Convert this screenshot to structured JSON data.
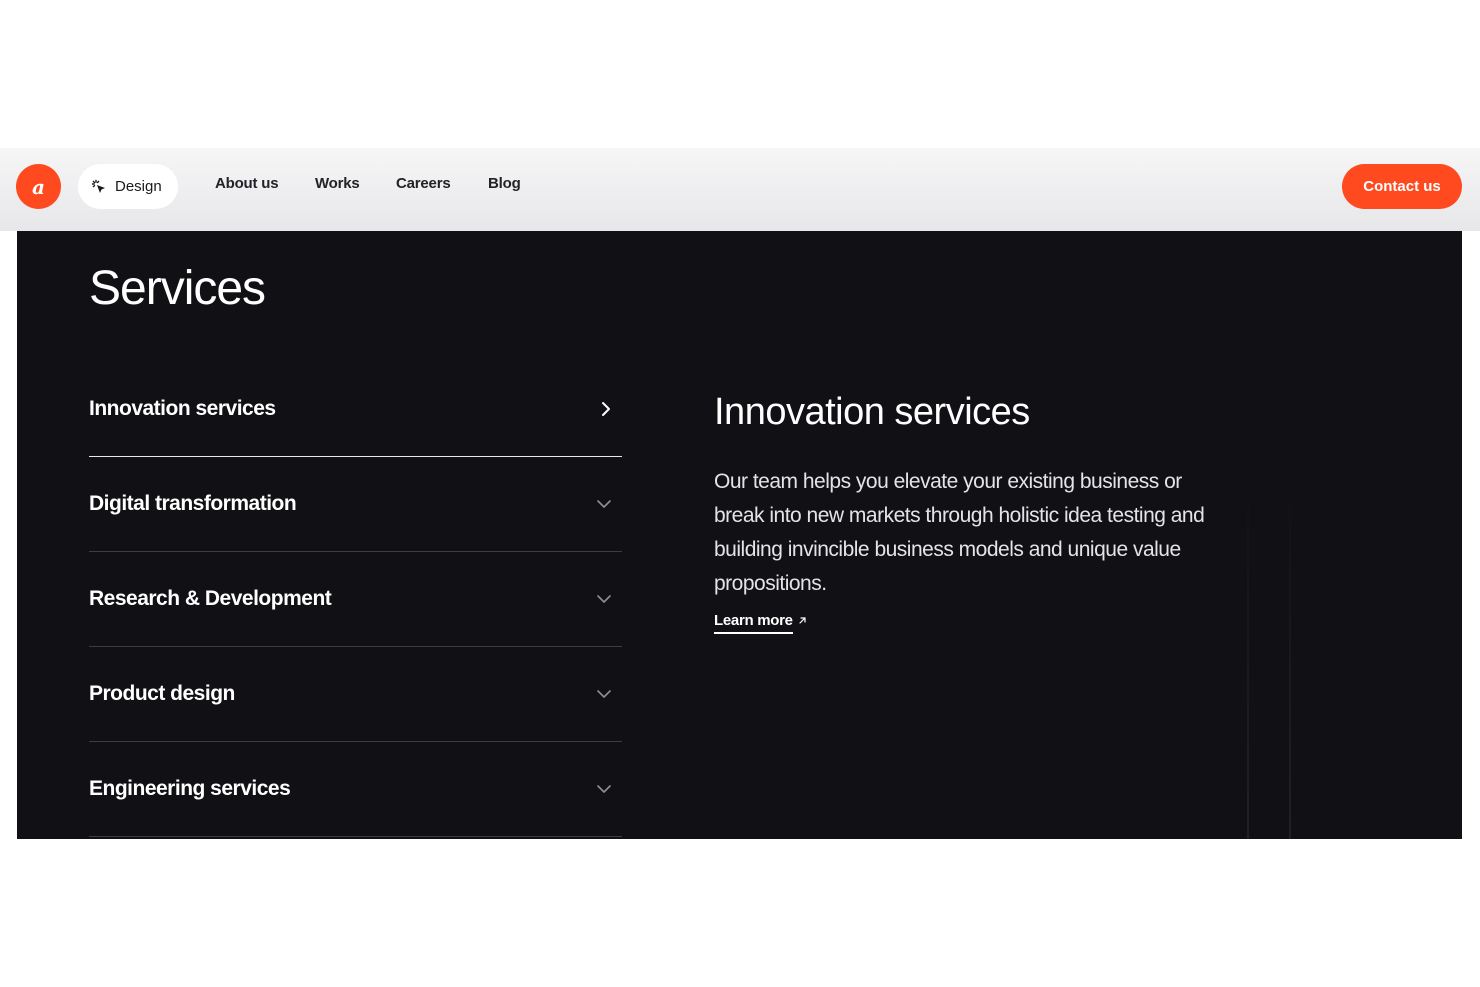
{
  "header": {
    "logo_letter": "a",
    "mode_pill": {
      "label": "Design",
      "icon": "sparkle-cursor-icon"
    },
    "nav": [
      {
        "label": "About us"
      },
      {
        "label": "Works"
      },
      {
        "label": "Careers"
      },
      {
        "label": "Blog"
      }
    ],
    "contact_label": "Contact us"
  },
  "services": {
    "title": "Services",
    "items": [
      {
        "label": "Innovation services",
        "icon": "chevron-right-icon",
        "active": true
      },
      {
        "label": "Digital transformation",
        "icon": "chevron-down-icon",
        "active": false
      },
      {
        "label": "Research & Development",
        "icon": "chevron-down-icon",
        "active": false
      },
      {
        "label": "Product design",
        "icon": "chevron-down-icon",
        "active": false
      },
      {
        "label": "Engineering services",
        "icon": "chevron-down-icon",
        "active": false
      }
    ],
    "detail": {
      "title": "Innovation services",
      "description": "Our team helps you elevate your existing business or break into new markets through holistic idea testing and building invincible business models and unique value propositions.",
      "link_label": "Learn more",
      "link_icon": "arrow-up-right-icon"
    }
  },
  "colors": {
    "accent": "#ff4a1f",
    "dark_background": "#111115",
    "header_background": "#ececee",
    "text_on_dark": "#ffffff"
  }
}
